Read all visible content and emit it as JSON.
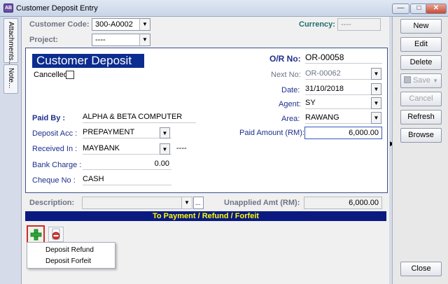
{
  "window": {
    "title": "Customer Deposit Entry",
    "icon": "app-icon",
    "icon_text": "AB"
  },
  "side_tabs": {
    "attachments": "Attachments...",
    "note": "Note..."
  },
  "header": {
    "customer_code_label": "Customer Code:",
    "customer_code_value": "300-A0002",
    "currency_label": "Currency:",
    "currency_value": "----",
    "project_label": "Project:",
    "project_value": "----"
  },
  "panel": {
    "title": "Customer Deposit",
    "cancelled_label": "Cancelled",
    "cancelled_checked": false,
    "or_no_label": "O/R No:",
    "or_no_value": "OR-00058",
    "next_no_label": "Next No:",
    "next_no_value": "OR-00062",
    "date_label": "Date:",
    "date_value": "31/10/2018",
    "agent_label": "Agent:",
    "agent_value": "SY",
    "area_label": "Area:",
    "area_value": "RAWANG",
    "paid_amount_label": "Paid Amount (RM):",
    "paid_amount_value": "6,000.00",
    "paid_by_label": "Paid By :",
    "paid_by_value": "ALPHA & BETA COMPUTER",
    "deposit_acc_label": "Deposit Acc :",
    "deposit_acc_value": "PREPAYMENT",
    "received_in_label": "Received In :",
    "received_in_value": "MAYBANK",
    "received_in_extra": "----",
    "bank_charge_label": "Bank Charge :",
    "bank_charge_value": "0.00",
    "cheque_no_label": "Cheque No :",
    "cheque_no_value": "CASH"
  },
  "footer": {
    "description_label": "Description:",
    "description_value": "",
    "ellipsis": "...",
    "unapplied_label": "Unapplied Amt (RM):",
    "unapplied_value": "6,000.00",
    "bar_text": "To Payment / Refund / Forfeit"
  },
  "popup_menu": {
    "items": [
      "Deposit Refund",
      "Deposit Forfeit"
    ]
  },
  "actions": {
    "new": "New",
    "edit": "Edit",
    "delete": "Delete",
    "save": "Save",
    "cancel": "Cancel",
    "refresh": "Refresh",
    "browse": "Browse",
    "close": "Close"
  },
  "colors": {
    "brand_band": "#0c2d8f",
    "bar": "#0a1a80",
    "bar_text": "#ffff00",
    "highlight": "#d9262a"
  }
}
